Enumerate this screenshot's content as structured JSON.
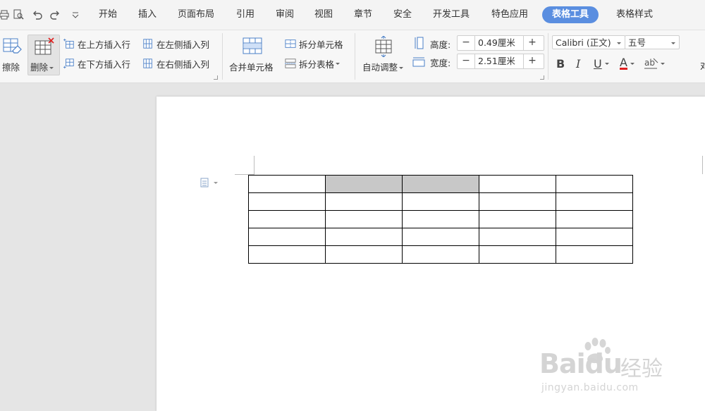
{
  "menubar": {
    "tabs": [
      "开始",
      "插入",
      "页面布局",
      "引用",
      "审阅",
      "视图",
      "章节",
      "安全",
      "开发工具",
      "特色应用",
      "表格工具",
      "表格样式"
    ],
    "active_tab": "表格工具"
  },
  "ribbon": {
    "erase_label": "擦除",
    "delete_label": "删除",
    "insert_above": "在上方插入行",
    "insert_below": "在下方插入行",
    "insert_left": "在左侧插入列",
    "insert_right": "在右侧插入列",
    "merge_cells": "合并单元格",
    "split_cells": "拆分单元格",
    "split_table": "拆分表格",
    "auto_adjust": "自动调整",
    "height_label": "高度:",
    "height_value": "0.49厘米",
    "width_label": "宽度:",
    "width_value": "2.51厘米",
    "minus": "−",
    "plus": "+",
    "font_name": "Calibri (正文)",
    "font_size": "五号",
    "bold": "B",
    "italic": "I",
    "underline": "U",
    "font_color": "A",
    "cut_off_label": "对"
  },
  "table": {
    "rows": 5,
    "cols": 5,
    "highlighted": [
      [
        0,
        1
      ],
      [
        0,
        2
      ]
    ]
  },
  "watermark": {
    "brand": "Baidu",
    "brand_cn": "经验",
    "url": "jingyan.baidu.com"
  },
  "colors": {
    "accent": "#5a8ee0",
    "cell_highlight": "#c8c8c8",
    "font_color_bar": "#e02020"
  }
}
